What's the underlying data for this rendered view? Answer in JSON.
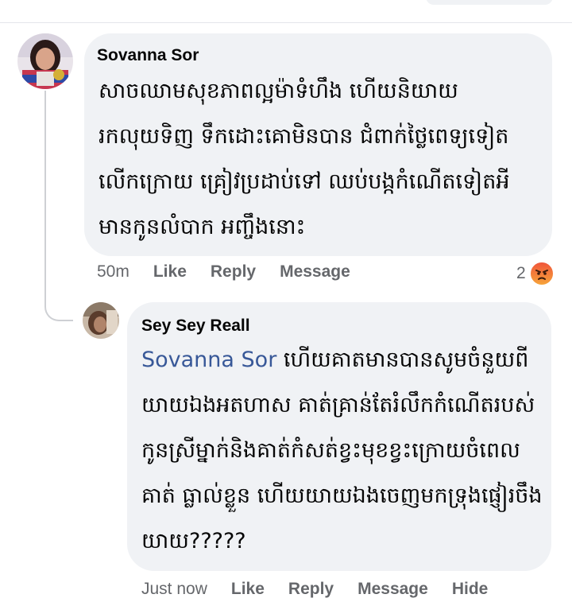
{
  "main_comment": {
    "author": "Sovanna Sor",
    "text": "សាចឈាមសុខភាពល្អម៉ាទំហឹង ហើយនិយាយរកលុយទិញ ទឹកដោះគោមិនបាន ជំពាក់ថ្លៃពេទ្យទៀត លើកក្រោយ គ្រៀវប្រដាប់ទៅ ឈប់បង្កកំណើតទៀតអី មានកូនលំបាក អញ្ចឹងនោះ",
    "time": "50m",
    "actions": {
      "like": "Like",
      "reply": "Reply",
      "message": "Message"
    },
    "reaction_count": "2",
    "reaction_icon": "angry-icon",
    "avatar_icon": "profile-photo"
  },
  "reply_comment": {
    "author": "Sey Sey Reall",
    "mention": "Sovanna Sor",
    "text": " ហើយគាតមានបានសូមចំនួយពី យាយឯងអតហាស គាត់គ្រាន់តែរំលឹកកំណើតរបស់ កូនស្រីម្នាក់និងគាត់កំសត់ខ្វះមុខខ្វះក្រោយចំពេលគាត់ ធ្លាល់ខ្លួន ហើយយាយឯងចេញមកទ្រុងផ្ញៀរចឹង យាយ?????",
    "time": "Just now",
    "actions": {
      "like": "Like",
      "reply": "Reply",
      "message": "Message",
      "hide": "Hide"
    },
    "avatar_icon": "profile-photo"
  },
  "colors": {
    "bubble": "#f0f2f5",
    "mention": "#385898",
    "meta": "#65676b",
    "thread_line": "#ced0d4"
  }
}
